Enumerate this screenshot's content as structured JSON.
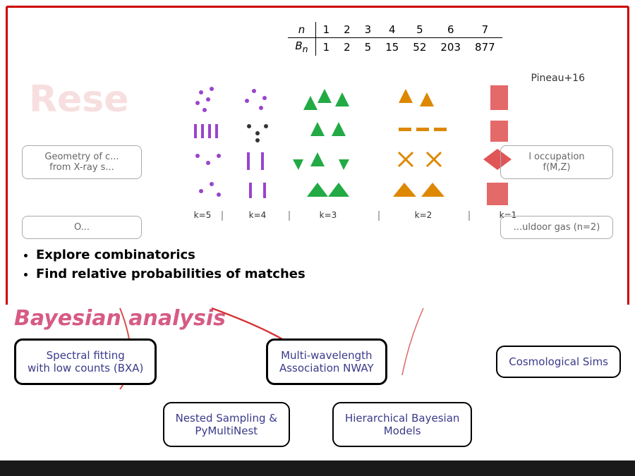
{
  "table": {
    "headers": [
      "n",
      "1",
      "2",
      "3",
      "4",
      "5",
      "6",
      "7"
    ],
    "row_label": "Bn",
    "row_values": [
      "1",
      "2",
      "5",
      "15",
      "52",
      "203",
      "877"
    ]
  },
  "reference": "Pineau+16",
  "research_partial": "Rese",
  "bullets": [
    "Explore combinatorics",
    "Find relative probabilities of matches"
  ],
  "left_box_1": "Geometry of c...\nfrom X-ray s...",
  "left_box_2": "O...",
  "right_box_1": "l occupation\nf(M,Z)",
  "right_box_2": "...uldoor gas (n=2)",
  "bottom": {
    "title": "Bayesian analysis",
    "boxes_row1": [
      "Spectral fitting\nwith low counts (BXA)",
      "Multi-wavelength\nAssociation NWAY",
      "Cosmological Sims"
    ],
    "boxes_row2": [
      "Nested Sampling &\nPyMultiNest",
      "Hierarchical Bayesian\nModels"
    ]
  },
  "k_labels": [
    "k=5",
    "k=4",
    "k=3",
    "k=2",
    "k=1"
  ]
}
